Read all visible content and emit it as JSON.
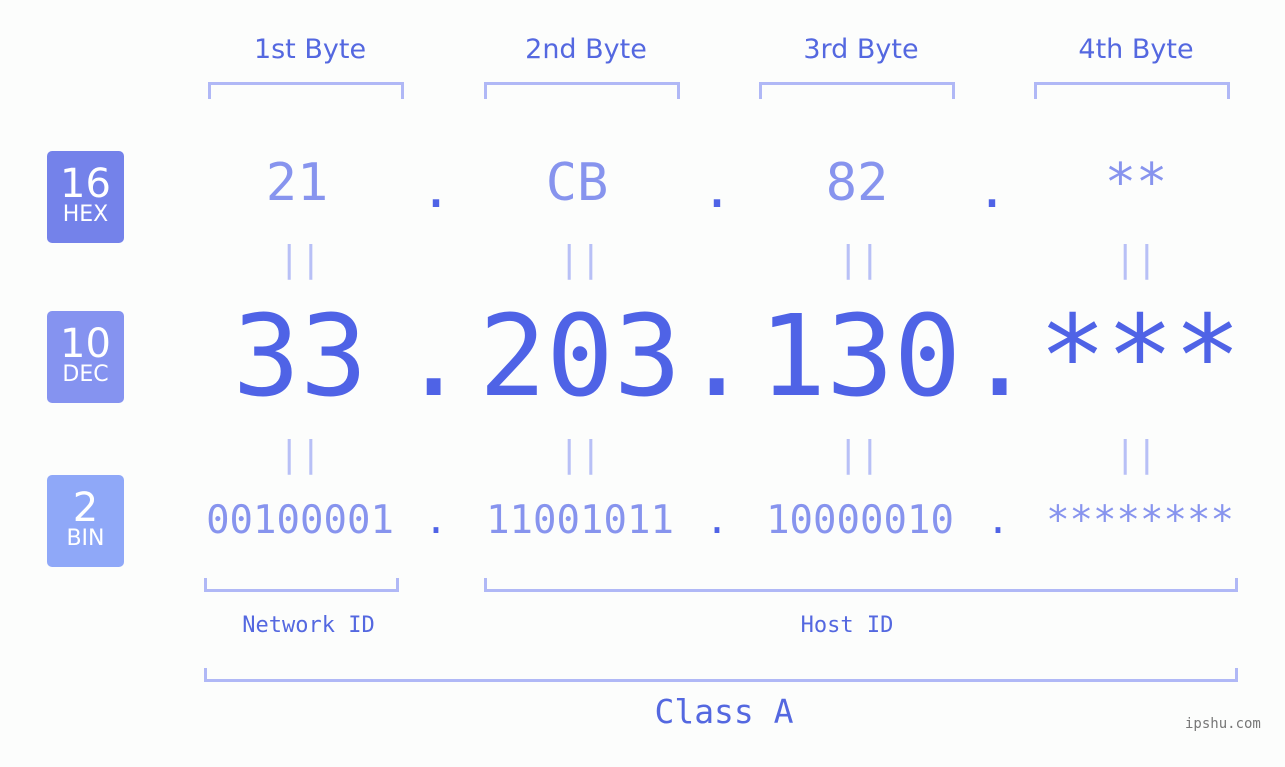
{
  "headers": [
    "1st Byte",
    "2nd Byte",
    "3rd Byte",
    "4th Byte"
  ],
  "badges": [
    {
      "num": "16",
      "label": "HEX",
      "color": "#7482ea"
    },
    {
      "num": "10",
      "label": "DEC",
      "color": "#8593f0"
    },
    {
      "num": "2",
      "label": "BIN",
      "color": "#8fa8f8"
    }
  ],
  "hex": [
    "21",
    "CB",
    "82",
    "**"
  ],
  "dec": [
    "33",
    "203",
    "130",
    "***"
  ],
  "bin": [
    "00100001",
    "11001011",
    "10000010",
    "********"
  ],
  "separator": ".",
  "equals": "||",
  "network_label": "Network ID",
  "host_label": "Host ID",
  "class_label": "Class A",
  "watermark": "ipshu.com"
}
